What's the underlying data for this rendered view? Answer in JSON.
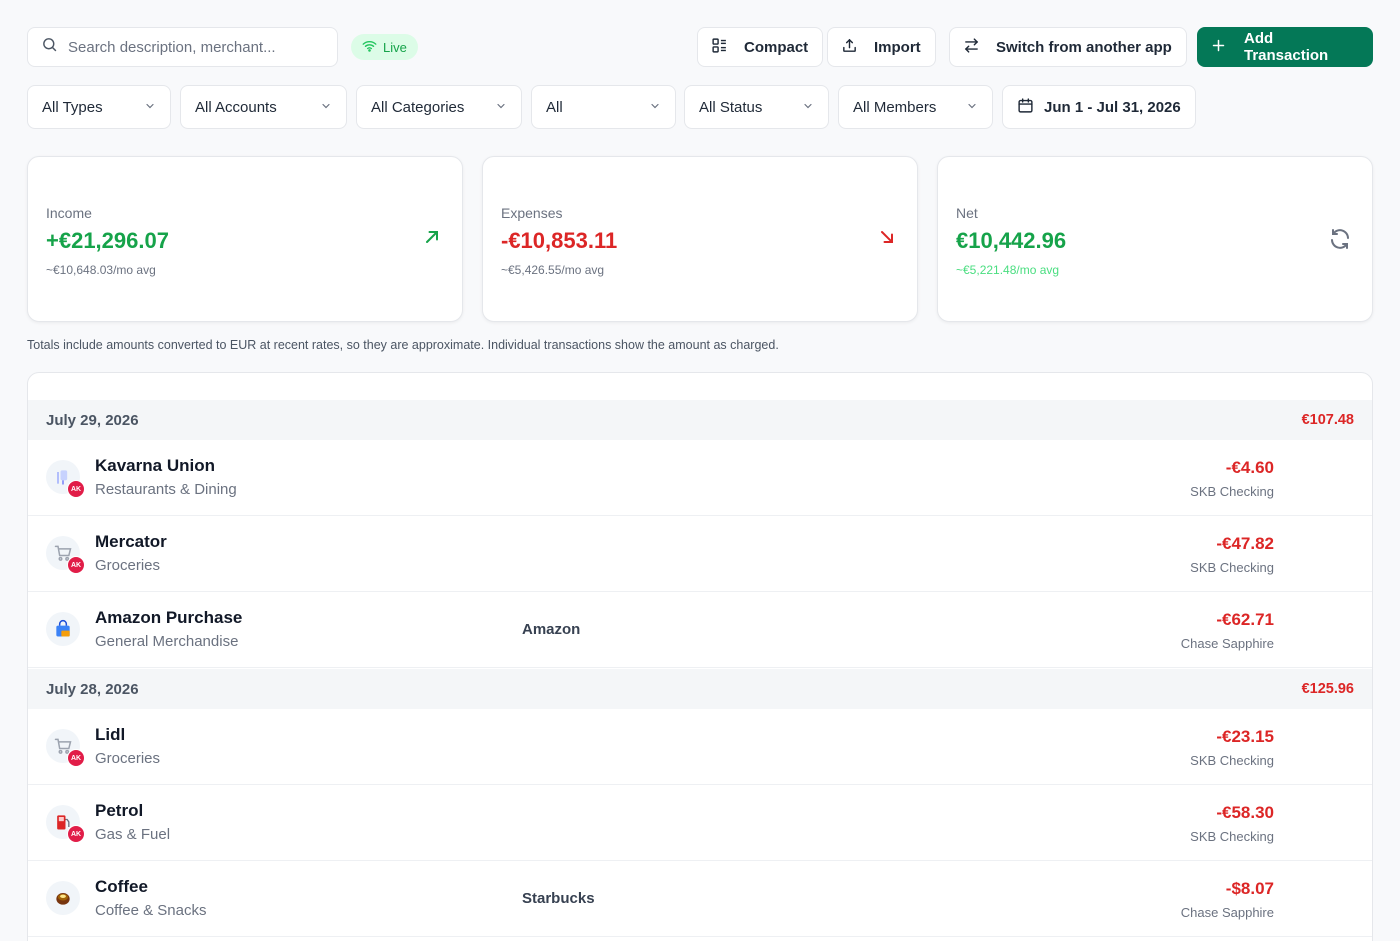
{
  "toolbar": {
    "search_placeholder": "Search description, merchant...",
    "live_label": "Live",
    "compact_label": "Compact",
    "import_label": "Import",
    "switch_label": "Switch from another app",
    "add_label": "Add Transaction"
  },
  "filters": {
    "types": "All Types",
    "accounts": "All Accounts",
    "categories": "All Categories",
    "all": "All",
    "status": "All Status",
    "members": "All Members",
    "date_range": "Jun 1 - Jul 31, 2026"
  },
  "summary": {
    "income": {
      "label": "Income",
      "amount": "+€21,296.07",
      "avg": "~€10,648.03/mo avg"
    },
    "expenses": {
      "label": "Expenses",
      "amount": "-€10,853.11",
      "avg": "~€5,426.55/mo avg"
    },
    "net": {
      "label": "Net",
      "amount": "€10,442.96",
      "avg": "~€5,221.48/mo avg"
    }
  },
  "note": "Totals include amounts converted to EUR at recent rates, so they are approximate. Individual transactions show the amount as charged.",
  "groups": [
    {
      "date": "July 29, 2026",
      "total": "€107.48",
      "rows": [
        {
          "name": "Kavarna Union",
          "category": "Restaurants & Dining",
          "merchant": "",
          "amount": "-€4.60",
          "account": "SKB Checking",
          "badge": "AK",
          "icon": "dining-icon"
        },
        {
          "name": "Mercator",
          "category": "Groceries",
          "merchant": "",
          "amount": "-€47.82",
          "account": "SKB Checking",
          "badge": "AK",
          "icon": "cart-icon"
        },
        {
          "name": "Amazon Purchase",
          "category": "General Merchandise",
          "merchant": "Amazon",
          "amount": "-€62.71",
          "account": "Chase Sapphire",
          "badge": "",
          "icon": "shopping-bag-icon"
        }
      ]
    },
    {
      "date": "July 28, 2026",
      "total": "€125.96",
      "rows": [
        {
          "name": "Lidl",
          "category": "Groceries",
          "merchant": "",
          "amount": "-€23.15",
          "account": "SKB Checking",
          "badge": "AK",
          "icon": "cart-icon"
        },
        {
          "name": "Petrol",
          "category": "Gas & Fuel",
          "merchant": "",
          "amount": "-€58.30",
          "account": "SKB Checking",
          "badge": "AK",
          "icon": "fuel-icon"
        },
        {
          "name": "Coffee",
          "category": "Coffee & Snacks",
          "merchant": "Starbucks",
          "amount": "-$8.07",
          "account": "Chase Sapphire",
          "badge": "",
          "icon": "coffee-icon"
        }
      ]
    }
  ],
  "colors": {
    "primary": "#047857",
    "income": "#16a34a",
    "expense": "#dc2626",
    "badge": "#e11d48"
  }
}
